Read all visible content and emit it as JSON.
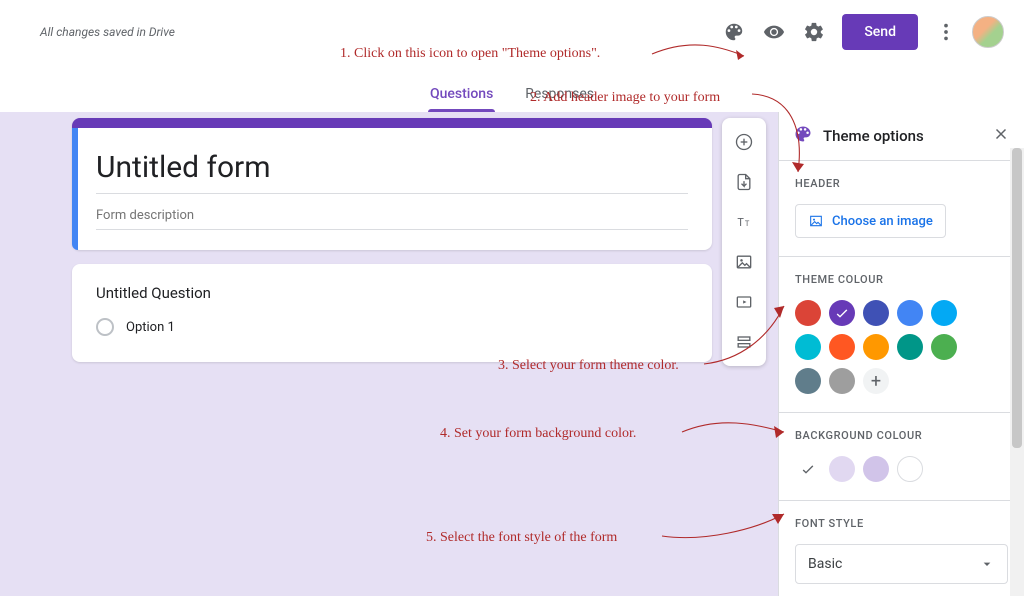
{
  "header": {
    "save_status": "All changes saved in Drive",
    "send_label": "Send"
  },
  "tabs": {
    "questions": "Questions",
    "responses": "Responses"
  },
  "form": {
    "title": "Untitled form",
    "description_placeholder": "Form description",
    "question_title": "Untitled Question",
    "option1": "Option 1"
  },
  "panel": {
    "title": "Theme options",
    "header_label": "HEADER",
    "choose_image": "Choose an image",
    "theme_colour_label": "THEME COLOUR",
    "background_colour_label": "BACKGROUND COLOUR",
    "font_style_label": "FONT STYLE",
    "font_value": "Basic",
    "theme_colours": [
      {
        "hex": "#DB4437",
        "selected": false
      },
      {
        "hex": "#673AB7",
        "selected": true
      },
      {
        "hex": "#3F51B5",
        "selected": false
      },
      {
        "hex": "#4285F4",
        "selected": false
      },
      {
        "hex": "#03A9F4",
        "selected": false
      },
      {
        "hex": "#00BCD4",
        "selected": false
      },
      {
        "hex": "#FF5722",
        "selected": false
      },
      {
        "hex": "#FF9800",
        "selected": false
      },
      {
        "hex": "#009688",
        "selected": false
      },
      {
        "hex": "#4CAF50",
        "selected": false
      },
      {
        "hex": "#607D8B",
        "selected": false
      },
      {
        "hex": "#9E9E9E",
        "selected": false
      }
    ],
    "background_colours": [
      {
        "hex": "#FFFFFF",
        "selected": true,
        "check": "dark"
      },
      {
        "hex": "#E1D8F1",
        "selected": false
      },
      {
        "hex": "#D1C4E9",
        "selected": false
      },
      {
        "hex": "#FFFFFF",
        "selected": false,
        "ring": true
      }
    ]
  },
  "annotations": {
    "a1": "1. Click on this icon to open \"Theme options\".",
    "a2": "2. Add header image to your form",
    "a3": "3. Select your form theme color.",
    "a4": "4. Set your form background color.",
    "a5": "5. Select the font style of the form"
  }
}
